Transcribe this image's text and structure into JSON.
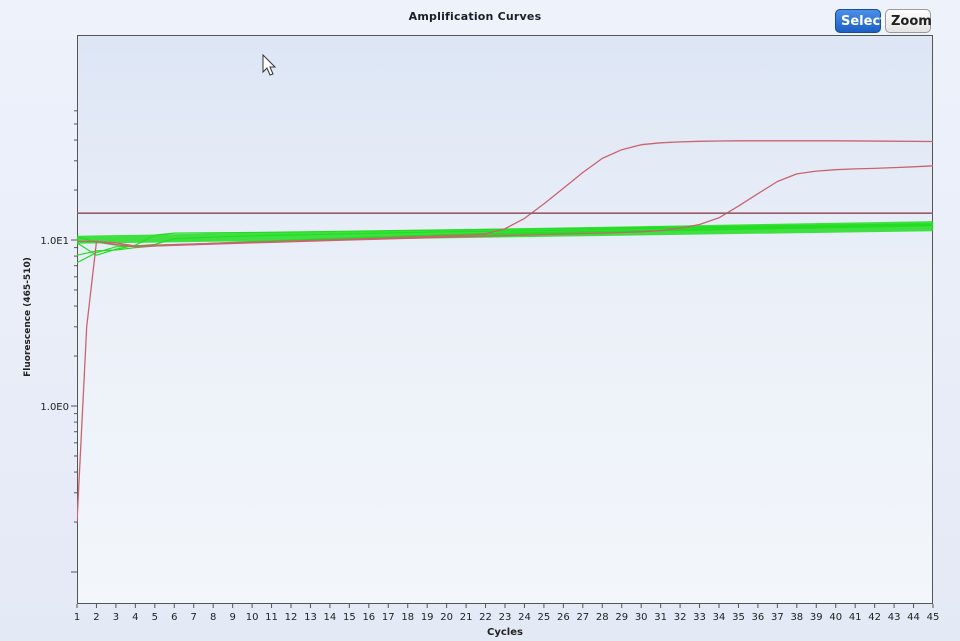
{
  "window": {
    "title": "Amplification Curves",
    "buttons": {
      "select_label": "Select",
      "zoom_label": "Zoom"
    }
  },
  "colors": {
    "background": "#e6ebf7",
    "threshold": "#9a5a6a",
    "sample_curves": "#22dd22",
    "positive_curves": "#c8646e",
    "select_button": "#2a6bd2"
  },
  "chart_data": {
    "type": "line",
    "title": "Amplification Curves",
    "xlabel": "Cycles",
    "ylabel": "Fluorescence (465-510)",
    "x_ticks": [
      1,
      2,
      3,
      4,
      5,
      6,
      7,
      8,
      9,
      10,
      11,
      12,
      13,
      14,
      15,
      16,
      17,
      18,
      19,
      20,
      21,
      22,
      23,
      24,
      25,
      26,
      27,
      28,
      29,
      30,
      31,
      32,
      33,
      34,
      35,
      36,
      37,
      38,
      39,
      40,
      41,
      42,
      43,
      44,
      45
    ],
    "xlim": [
      1,
      45
    ],
    "y_scale": "log",
    "y_tick_labels": [
      {
        "label": "1.0E1",
        "value": 10
      },
      {
        "label": "1.0E0",
        "value": 1
      }
    ],
    "ylim": [
      0.1,
      60
    ],
    "threshold": {
      "y": 14.5
    },
    "legend": "none",
    "grid": false,
    "green_band": {
      "x": [
        1,
        45
      ],
      "y_low_start": 9.5,
      "y_high_start": 10.6,
      "y_low_end": 11.3,
      "y_high_end": 13.0
    },
    "series": [
      {
        "color": "#22dd22",
        "x": [
          1,
          2,
          3,
          4,
          5,
          6,
          10,
          15,
          20,
          25,
          30,
          35,
          40,
          45
        ],
        "y": [
          9.6,
          8.1,
          8.8,
          9.3,
          10.7,
          11.0,
          11.1,
          11.3,
          11.5,
          11.7,
          11.9,
          12.1,
          12.3,
          12.5
        ]
      },
      {
        "color": "#22dd22",
        "x": [
          1,
          2,
          3,
          4,
          5,
          6,
          10,
          15,
          20,
          25,
          30,
          35,
          40,
          45
        ],
        "y": [
          7.3,
          8.4,
          9.1,
          9.2,
          9.4,
          10.2,
          10.6,
          10.9,
          11.2,
          11.4,
          11.7,
          11.9,
          12.1,
          12.3
        ]
      },
      {
        "color": "#22dd22",
        "x": [
          1,
          2,
          3,
          4,
          5,
          10,
          15,
          20,
          25,
          30,
          35,
          40,
          45
        ],
        "y": [
          8.1,
          8.6,
          8.7,
          9.0,
          9.2,
          9.8,
          10.3,
          10.8,
          11.1,
          11.4,
          11.7,
          12.0,
          12.4
        ]
      },
      {
        "color": "#22dd22",
        "x": [
          1,
          2,
          3,
          4,
          5,
          10,
          15,
          20,
          25,
          30,
          35,
          40,
          45
        ],
        "y": [
          10.5,
          9.7,
          9.3,
          9.2,
          9.3,
          9.7,
          10.2,
          10.6,
          11.0,
          11.3,
          11.6,
          11.9,
          12.2
        ]
      },
      {
        "color": "#c8646e",
        "x": [
          1,
          1.5,
          2,
          3,
          4,
          5,
          10,
          15,
          20,
          21,
          22,
          23,
          24,
          25,
          26,
          27,
          28,
          29,
          30,
          31,
          32,
          33,
          34,
          35,
          40,
          45
        ],
        "y": [
          0.2,
          3.0,
          9.8,
          9.6,
          9.2,
          9.3,
          9.7,
          10.1,
          10.6,
          10.7,
          10.9,
          11.7,
          13.5,
          16.5,
          20.5,
          25.5,
          31,
          35,
          37.5,
          38.5,
          39,
          39.3,
          39.5,
          39.6,
          39.6,
          39.2
        ]
      },
      {
        "color": "#c8646e",
        "x": [
          1,
          2,
          3,
          4,
          5,
          10,
          15,
          20,
          25,
          28,
          30,
          31,
          32,
          33,
          34,
          35,
          36,
          37,
          38,
          39,
          40,
          41,
          42,
          43,
          44,
          45
        ],
        "y": [
          9.8,
          9.8,
          9.4,
          9.1,
          9.2,
          9.6,
          10.0,
          10.4,
          10.8,
          11.0,
          11.2,
          11.4,
          11.8,
          12.4,
          13.6,
          16.0,
          19.0,
          22.5,
          25.0,
          26.0,
          26.5,
          26.8,
          27.0,
          27.3,
          27.6,
          28.0
        ]
      }
    ]
  }
}
